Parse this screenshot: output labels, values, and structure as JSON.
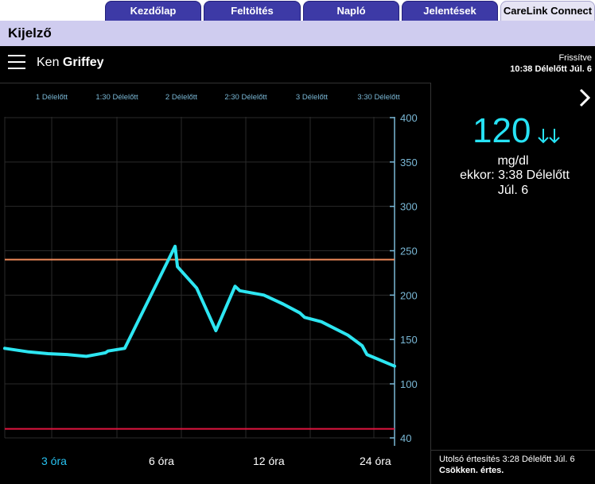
{
  "tabs": [
    {
      "label": "Kezdőlap",
      "active": false
    },
    {
      "label": "Feltöltés",
      "active": false
    },
    {
      "label": "Napló",
      "active": false
    },
    {
      "label": "Jelentések",
      "active": false
    },
    {
      "label": "CareLink Connect",
      "active": true
    }
  ],
  "page_title": "Kijelző",
  "user": {
    "first_name": "Ken",
    "last_name": "Griffey"
  },
  "refresh": {
    "label": "Frissítve",
    "time": "10:38 Délelőtt Júl. 6"
  },
  "current": {
    "value": "120",
    "trend": "double-down-arrow",
    "unit": "mg/dl",
    "time": "ekkor: 3:38 Délelőtt",
    "date": "Júl. 6"
  },
  "alert": {
    "line1": "Utolsó értesítés 3:28 Délelőtt Júl. 6",
    "line2": "Csökken. értes."
  },
  "range_buttons": [
    {
      "label": "3 óra",
      "active": true
    },
    {
      "label": "6 óra",
      "active": false
    },
    {
      "label": "12 óra",
      "active": false
    },
    {
      "label": "24 óra",
      "active": false
    }
  ],
  "colors": {
    "line": "#2de6f2",
    "high_limit": "#f08a5a",
    "low_limit": "#e0153f",
    "active_tab": "#3d3aa6",
    "header_band": "#cfccef"
  },
  "chart_data": {
    "type": "line",
    "x_tick_labels": [
      "1 Délelőtt",
      "1:30 Délelőtt",
      "2 Délelőtt",
      "2:30 Délelőtt",
      "3 Délelőtt",
      "3:30 Délelőtt"
    ],
    "x_ticks_hours": [
      1.0,
      1.5,
      2.0,
      2.5,
      3.0,
      3.5
    ],
    "y_ticks": [
      400,
      350,
      300,
      250,
      200,
      150,
      100,
      40
    ],
    "xlim_hours": [
      0.42,
      3.67
    ],
    "high_limit": 240,
    "low_limit": 50,
    "series": [
      {
        "x_hours": [
          0.42,
          0.62,
          0.78,
          0.94,
          1.1,
          1.26,
          1.28,
          1.42,
          1.84,
          1.86,
          2.02,
          2.18,
          2.34,
          2.38,
          2.58,
          2.74,
          2.88,
          2.92,
          3.06,
          3.28,
          3.4,
          3.44,
          3.67
        ],
        "y": [
          140,
          136,
          134,
          133,
          131,
          135,
          137,
          140,
          255,
          232,
          208,
          160,
          210,
          205,
          200,
          190,
          180,
          175,
          170,
          155,
          143,
          133,
          120
        ]
      }
    ],
    "grid": true,
    "ylim": [
      40,
      400
    ],
    "y_axis_side": "right"
  }
}
